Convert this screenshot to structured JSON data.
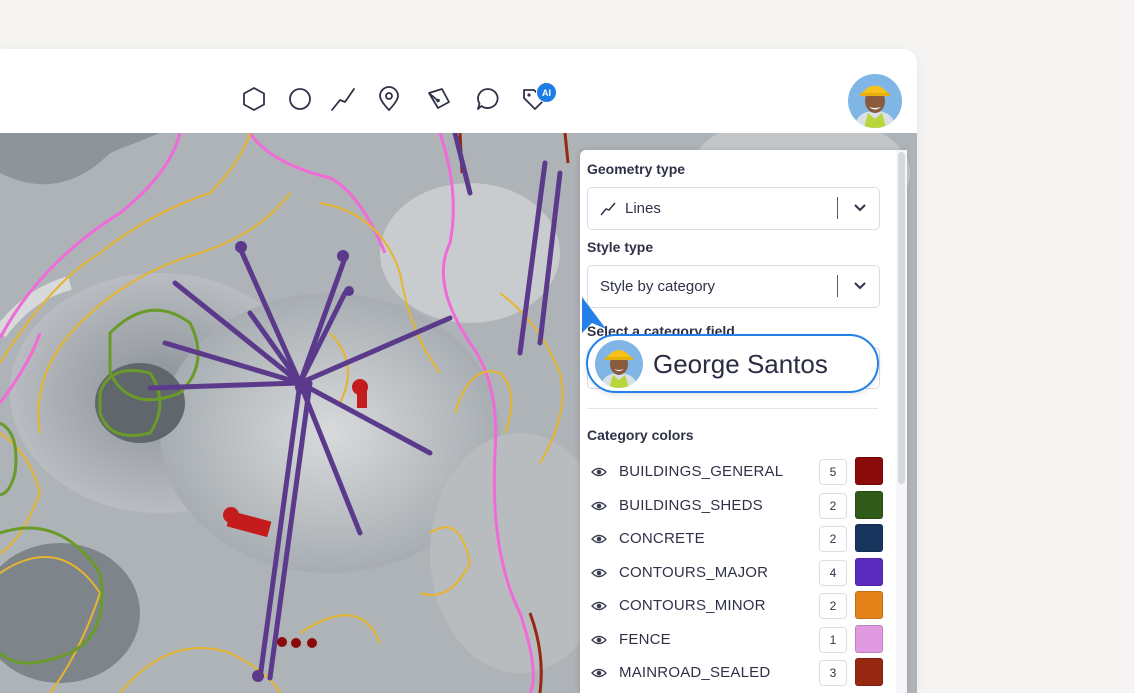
{
  "toolbar": {
    "tools": [
      {
        "icon": "polygon-icon",
        "interactable": true
      },
      {
        "icon": "circle-icon",
        "interactable": true
      },
      {
        "icon": "line-icon",
        "interactable": true
      },
      {
        "icon": "marker-icon",
        "interactable": true
      },
      {
        "icon": "pen-icon",
        "interactable": true
      },
      {
        "icon": "comment-icon",
        "interactable": true
      },
      {
        "icon": "ai-tag-icon",
        "interactable": true
      }
    ],
    "ai_badge": "AI"
  },
  "panel": {
    "geometry_label": "Geometry type",
    "geometry_value": "Lines",
    "style_label": "Style type",
    "style_value": "Style by category",
    "category_field_label": "Select a category field",
    "category_colors_label": "Category colors",
    "categories": [
      {
        "name": "BUILDINGS_GENERAL",
        "count": "5",
        "color": "#8b0a0a"
      },
      {
        "name": "BUILDINGS_SHEDS",
        "count": "2",
        "color": "#2f5a17"
      },
      {
        "name": "CONCRETE",
        "count": "2",
        "color": "#18355e"
      },
      {
        "name": "CONTOURS_MAJOR",
        "count": "4",
        "color": "#5a2bbf"
      },
      {
        "name": "CONTOURS_MINOR",
        "count": "2",
        "color": "#e4821a"
      },
      {
        "name": "FENCE",
        "count": "1",
        "color": "#e09adf"
      },
      {
        "name": "MAINROAD_SEALED",
        "count": "3",
        "color": "#962811"
      }
    ]
  },
  "collaborator": {
    "name": "George Santos"
  },
  "colors": {
    "accent": "#2380e8",
    "contour_minor": "#e6b52d",
    "fence": "#f06ad8",
    "vegetation": "#6a9a2a",
    "conveyor": "#5b3a8c"
  }
}
